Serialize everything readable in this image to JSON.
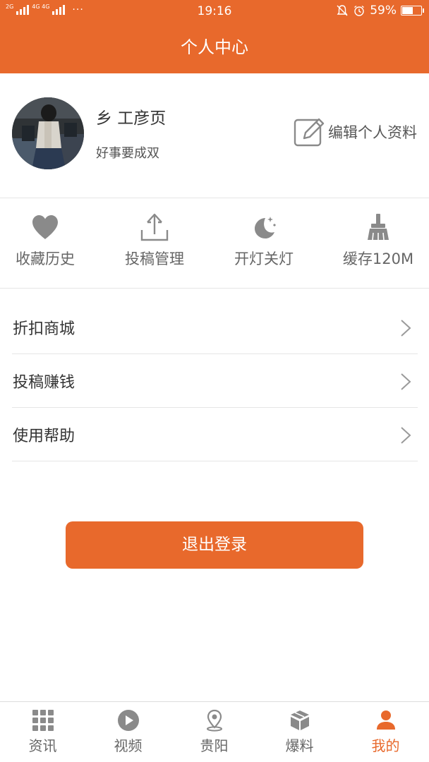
{
  "status_bar": {
    "network_2g": "2G",
    "network_4g": "4G 4G",
    "dots": "···",
    "time": "19:16",
    "battery_text": "59%",
    "battery_level": 0.59
  },
  "header": {
    "title": "个人中心"
  },
  "profile": {
    "username": "乡 工彦页",
    "signature": "好事要成双",
    "edit_label": "编辑个人资料"
  },
  "quick_actions": [
    {
      "label": "收藏历史",
      "icon": "heart-icon"
    },
    {
      "label": "投稿管理",
      "icon": "upload-icon"
    },
    {
      "label": "开灯关灯",
      "icon": "moon-icon"
    },
    {
      "label": "缓存120M",
      "icon": "broom-icon"
    }
  ],
  "menu": [
    {
      "label": "折扣商城"
    },
    {
      "label": "投稿赚钱"
    },
    {
      "label": "使用帮助"
    }
  ],
  "logout_label": "退出登录",
  "tabs": [
    {
      "label": "资讯",
      "icon": "grid-icon",
      "active": false
    },
    {
      "label": "视频",
      "icon": "play-icon",
      "active": false
    },
    {
      "label": "贵阳",
      "icon": "location-pin-icon",
      "active": false
    },
    {
      "label": "爆料",
      "icon": "box-icon",
      "active": false
    },
    {
      "label": "我的",
      "icon": "user-icon",
      "active": true
    }
  ],
  "colors": {
    "accent": "#e8692c",
    "icon_gray": "#8a8a8a",
    "divider": "#e6e6e6"
  }
}
